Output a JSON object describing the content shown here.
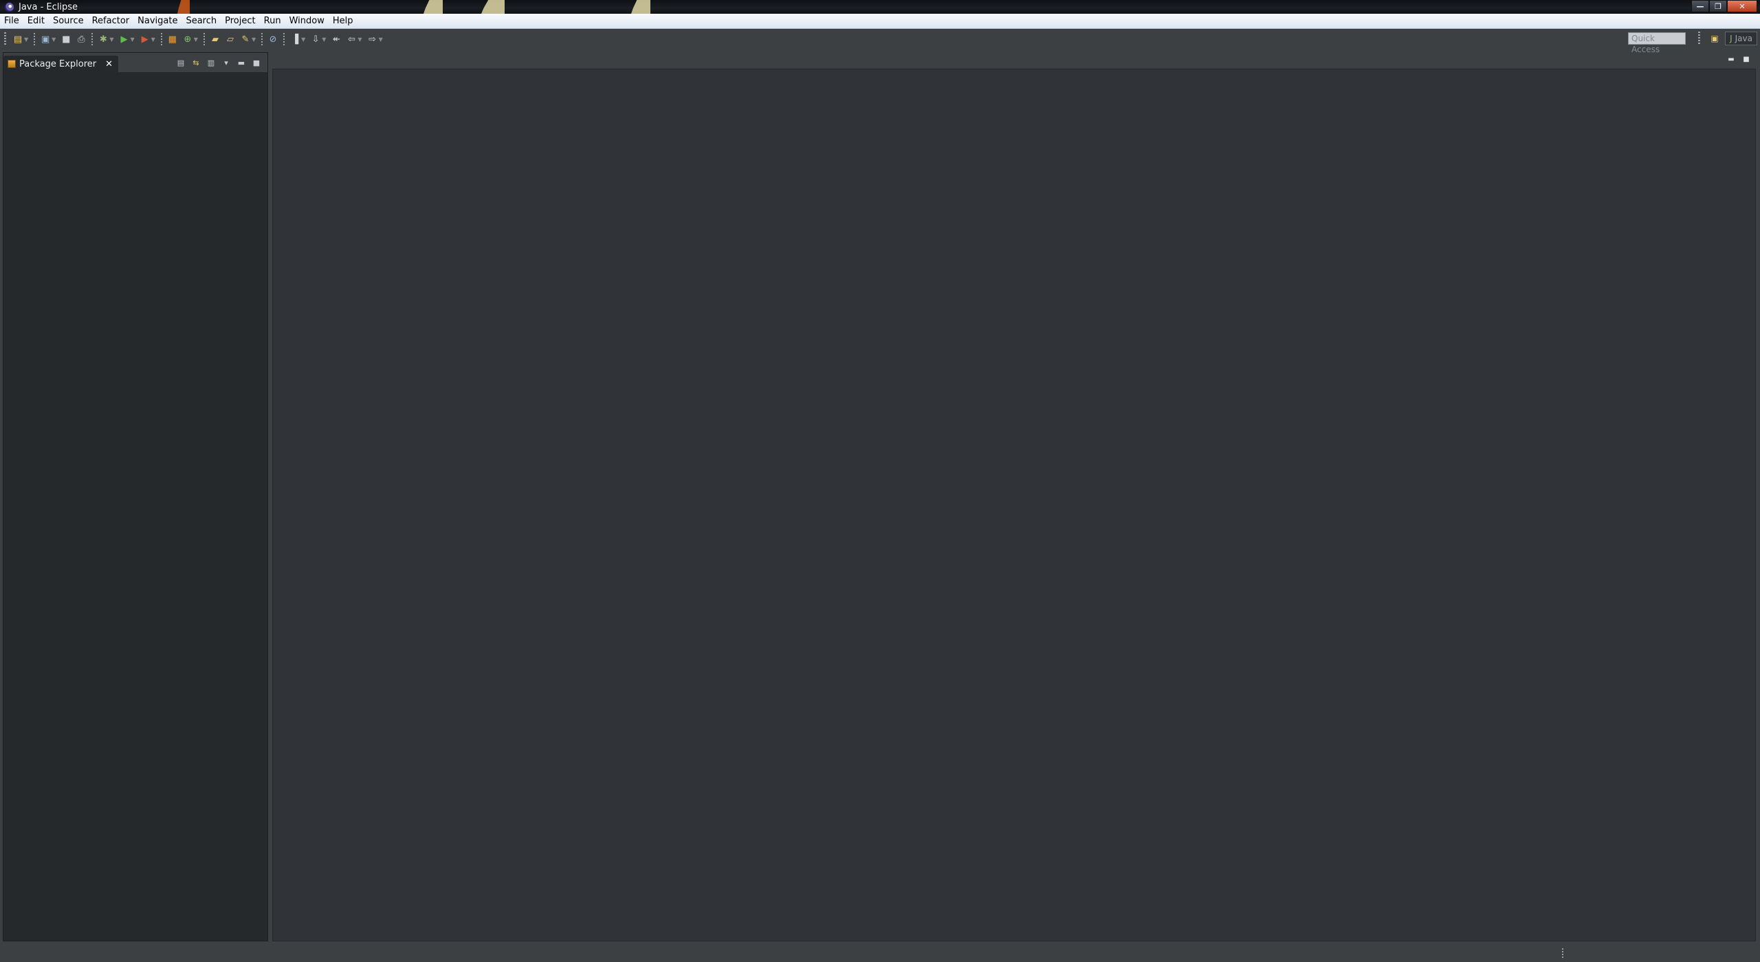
{
  "window": {
    "title": "Java - Eclipse",
    "controls": {
      "minimize": "—",
      "restore": "❐",
      "close": "✕"
    }
  },
  "menu": {
    "items": [
      {
        "label": "File",
        "mnemonic": "F"
      },
      {
        "label": "Edit",
        "mnemonic": "E"
      },
      {
        "label": "Source",
        "mnemonic": "S"
      },
      {
        "label": "Refactor",
        "mnemonic": "t"
      },
      {
        "label": "Navigate",
        "mnemonic": "N"
      },
      {
        "label": "Search",
        "mnemonic": "a"
      },
      {
        "label": "Project",
        "mnemonic": "P"
      },
      {
        "label": "Run",
        "mnemonic": "R"
      },
      {
        "label": "Window",
        "mnemonic": "W"
      },
      {
        "label": "Help",
        "mnemonic": "H"
      }
    ]
  },
  "toolbar": {
    "quick_access_placeholder": "Quick Access",
    "perspective_label": "Java",
    "icons": [
      "new-icon",
      "save-icon",
      "save-all-icon",
      "print-icon",
      "debug-icon",
      "run-icon",
      "external-tools-icon",
      "new-java-project-icon",
      "new-class-icon",
      "open-type-icon",
      "open-task-icon",
      "search-icon",
      "toggle-mark-occurrences-icon",
      "show-whitespace-icon",
      "next-annotation-icon",
      "back-icon",
      "forward-icon"
    ]
  },
  "package_explorer": {
    "tab_label": "Package Explorer",
    "close_glyph": "✕"
  },
  "editor": {},
  "colors": {
    "background": "#3c4043",
    "view_background": "#26292c",
    "editor_background": "#303438",
    "menubar_background": "#e6edf5"
  }
}
